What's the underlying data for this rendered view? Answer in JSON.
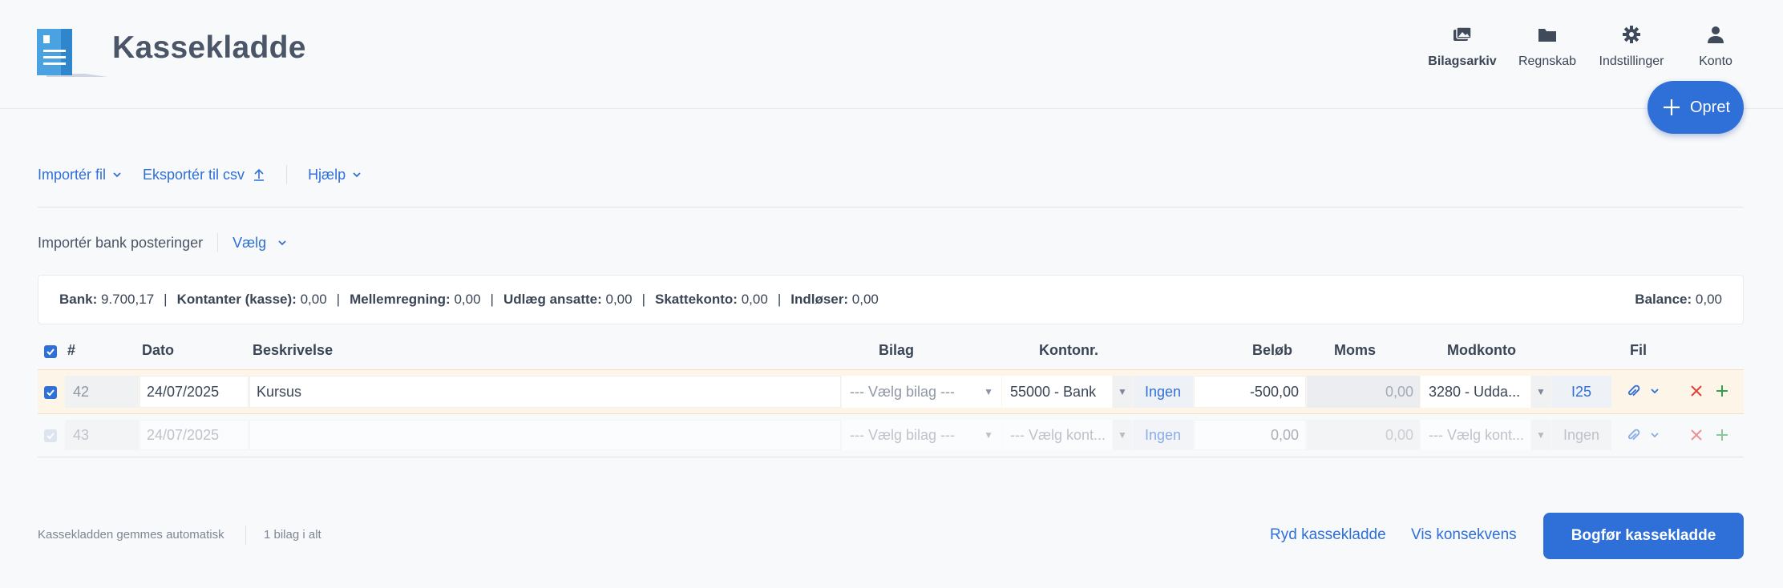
{
  "app": {
    "title": "Kassekladde"
  },
  "nav": [
    {
      "label": "Bilagsarkiv",
      "icon": "images-icon"
    },
    {
      "label": "Regnskab",
      "icon": "folder-icon"
    },
    {
      "label": "Indstillinger",
      "icon": "gear-icon"
    },
    {
      "label": "Konto",
      "icon": "user-icon"
    }
  ],
  "create_button": {
    "label": "Opret"
  },
  "toolbar": {
    "import": "Importér fil",
    "export": "Eksportér til csv",
    "help": "Hjælp"
  },
  "bank_import": {
    "label": "Importér bank posteringer",
    "select": "Vælg"
  },
  "summary": {
    "items": [
      {
        "label": "Bank:",
        "value": "9.700,17"
      },
      {
        "label": "Kontanter (kasse):",
        "value": "0,00"
      },
      {
        "label": "Mellemregning:",
        "value": "0,00"
      },
      {
        "label": "Udlæg ansatte:",
        "value": "0,00"
      },
      {
        "label": "Skattekonto:",
        "value": "0,00"
      },
      {
        "label": "Indløser:",
        "value": "0,00"
      }
    ],
    "balance_label": "Balance:",
    "balance_value": "0,00"
  },
  "table": {
    "columns": {
      "num": "#",
      "date": "Dato",
      "desc": "Beskrivelse",
      "bilag": "Bilag",
      "konto": "Kontonr.",
      "belob": "Beløb",
      "moms": "Moms",
      "modkonto": "Modkonto",
      "fil": "Fil"
    },
    "rows": [
      {
        "num": "42",
        "date": "24/07/2025",
        "desc": "Kursus",
        "bilag": "--- Vælg bilag ---",
        "konto": "55000 - Bank",
        "ingen": "Ingen",
        "belob": "-500,00",
        "moms": "0,00",
        "modkonto": "3280 - Udda...",
        "tax": "I25"
      },
      {
        "num": "43",
        "date": "24/07/2025",
        "desc": "",
        "bilag": "--- Vælg bilag ---",
        "konto": "--- Vælg kont...",
        "ingen": "Ingen",
        "belob": "0,00",
        "moms": "0,00",
        "modkonto": "--- Vælg kont...",
        "tax": "Ingen"
      }
    ]
  },
  "footer": {
    "autosave": "Kassekladden gemmes automatisk",
    "count": "1 bilag i alt",
    "clear": "Ryd kassekladde",
    "consequence": "Vis konsekvens",
    "post": "Bogfør kassekladde"
  },
  "colors": {
    "accent": "#2f6fd8",
    "row_highlight": "#fdf5e8",
    "delete": "#e0413b",
    "add": "#2fa24a"
  }
}
